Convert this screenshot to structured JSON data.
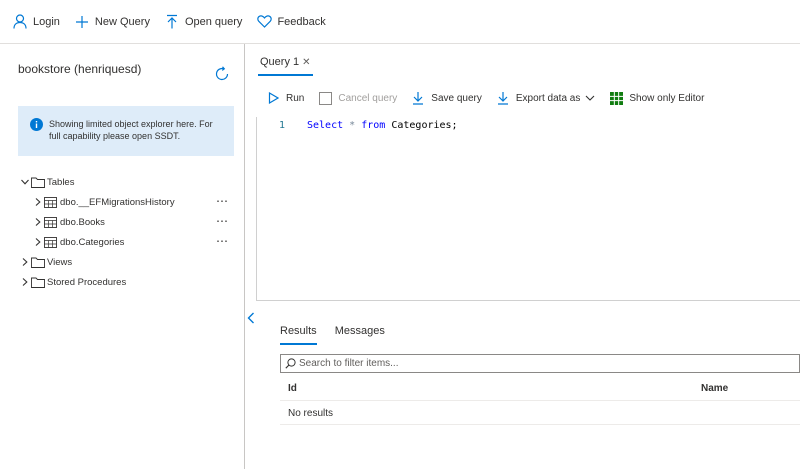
{
  "topbar": {
    "login_label": "Login",
    "new_query_label": "New Query",
    "open_query_label": "Open query",
    "feedback_label": "Feedback"
  },
  "explorer": {
    "database_title": "bookstore (henriquesd)",
    "info_message": "Showing limited object explorer here. For full capability please open SSDT.",
    "tree": {
      "tables_label": "Tables",
      "tables": [
        {
          "name": "dbo.__EFMigrationsHistory",
          "more": "⋯"
        },
        {
          "name": "dbo.Books",
          "more": "⋯"
        },
        {
          "name": "dbo.Categories",
          "more": "⋯"
        }
      ],
      "views_label": "Views",
      "stored_procedures_label": "Stored Procedures"
    }
  },
  "editor_tab": {
    "label": "Query 1",
    "close": "✕"
  },
  "toolbar": {
    "run_label": "Run",
    "cancel_label": "Cancel query",
    "save_label": "Save query",
    "export_label": "Export data as",
    "show_editor_label": "Show only Editor"
  },
  "editor": {
    "line_number": "1",
    "keyword1": "Select",
    "star": "*",
    "keyword2": "from",
    "rest": "Categories;"
  },
  "results": {
    "tabs": [
      {
        "label": "Results",
        "active": true
      },
      {
        "label": "Messages",
        "active": false
      }
    ],
    "filter_placeholder": "Search to filter items...",
    "columns": [
      "Id",
      "Name"
    ],
    "empty_text": "No results"
  },
  "colors": {
    "accent": "#0078d4",
    "info_bg": "#deecf9",
    "grid_icon": "#107c10"
  }
}
